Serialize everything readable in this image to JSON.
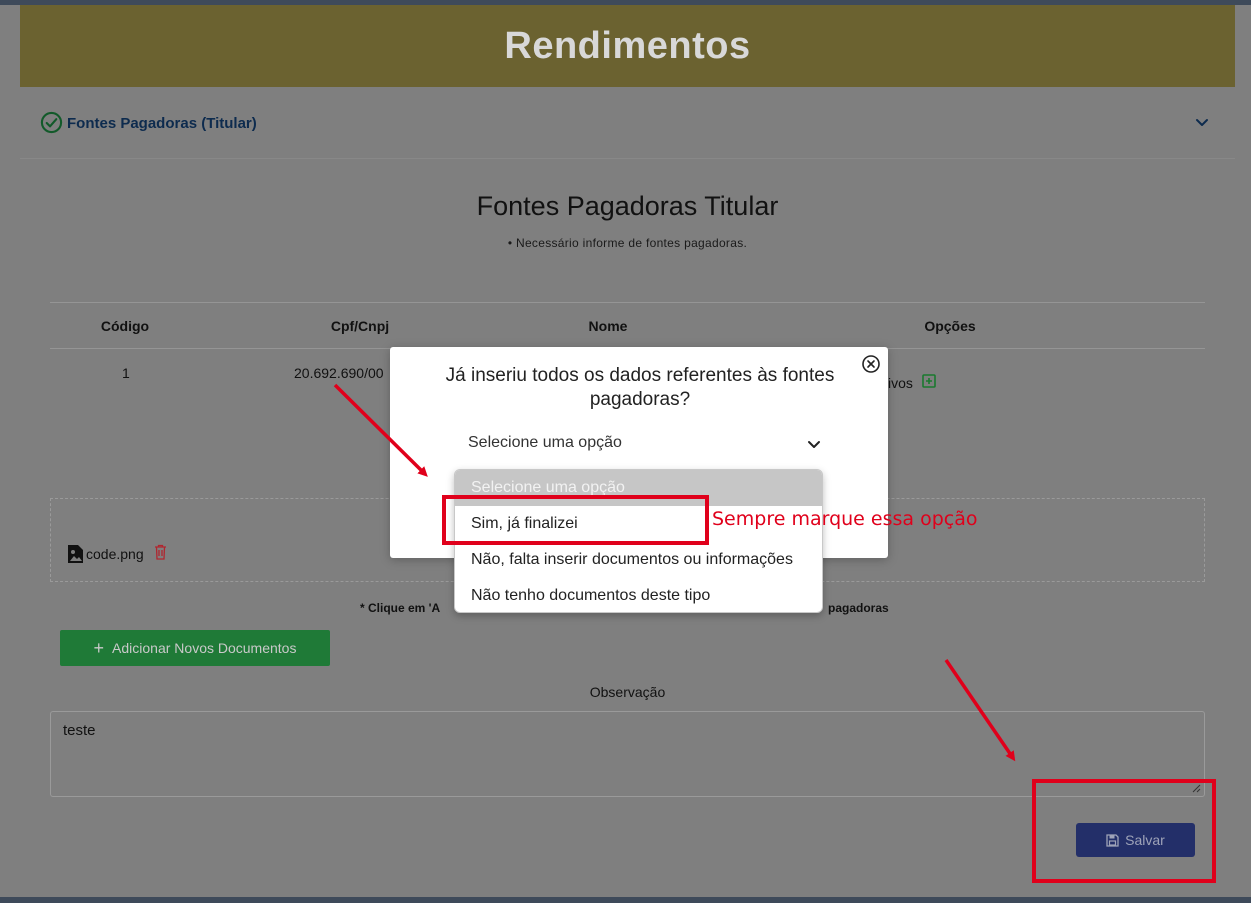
{
  "header": {
    "title": "Rendimentos"
  },
  "accordion": {
    "title": "Fontes Pagadoras (Titular)"
  },
  "section": {
    "title": "Fontes Pagadoras Titular",
    "subtitle": "• Necessário informe de fontes pagadoras."
  },
  "table": {
    "headers": [
      "Código",
      "Cpf/Cnpj",
      "Nome",
      "Opções"
    ],
    "rows": [
      {
        "codigo": "1",
        "cpf_cnpj": "20.692.690/00",
        "opcoes_partial": "ivos"
      }
    ]
  },
  "document": {
    "file_name": "code.png"
  },
  "hint": {
    "left": "* Clique em 'A",
    "right": "pagadoras"
  },
  "add_button": {
    "label": "Adicionar Novos Documentos"
  },
  "observation": {
    "label": "Observação",
    "value": "teste"
  },
  "save_button": {
    "label": "Salvar"
  },
  "modal": {
    "question": "Já inseriu todos os dados referentes às fontes pagadoras?",
    "select_value": "Selecione uma opção",
    "options": [
      "Selecione uma opção",
      "Sim, já finalizei",
      "Não, falta inserir documentos ou informações",
      "Não tenho documentos deste tipo"
    ]
  },
  "annotation": {
    "callout": "Sempre marque essa opção",
    "color": "#e0001b"
  },
  "colors": {
    "title_bar": "#6b6230",
    "add_button": "#1f7a37",
    "save_button": "#232f69",
    "accent_text": "#0d2b4e"
  },
  "icons": [
    "check-circle-icon",
    "chevron-down-icon",
    "plus-square-icon",
    "image-file-icon",
    "trash-icon",
    "plus-icon",
    "floppy-disk-icon",
    "close-circle-icon"
  ]
}
